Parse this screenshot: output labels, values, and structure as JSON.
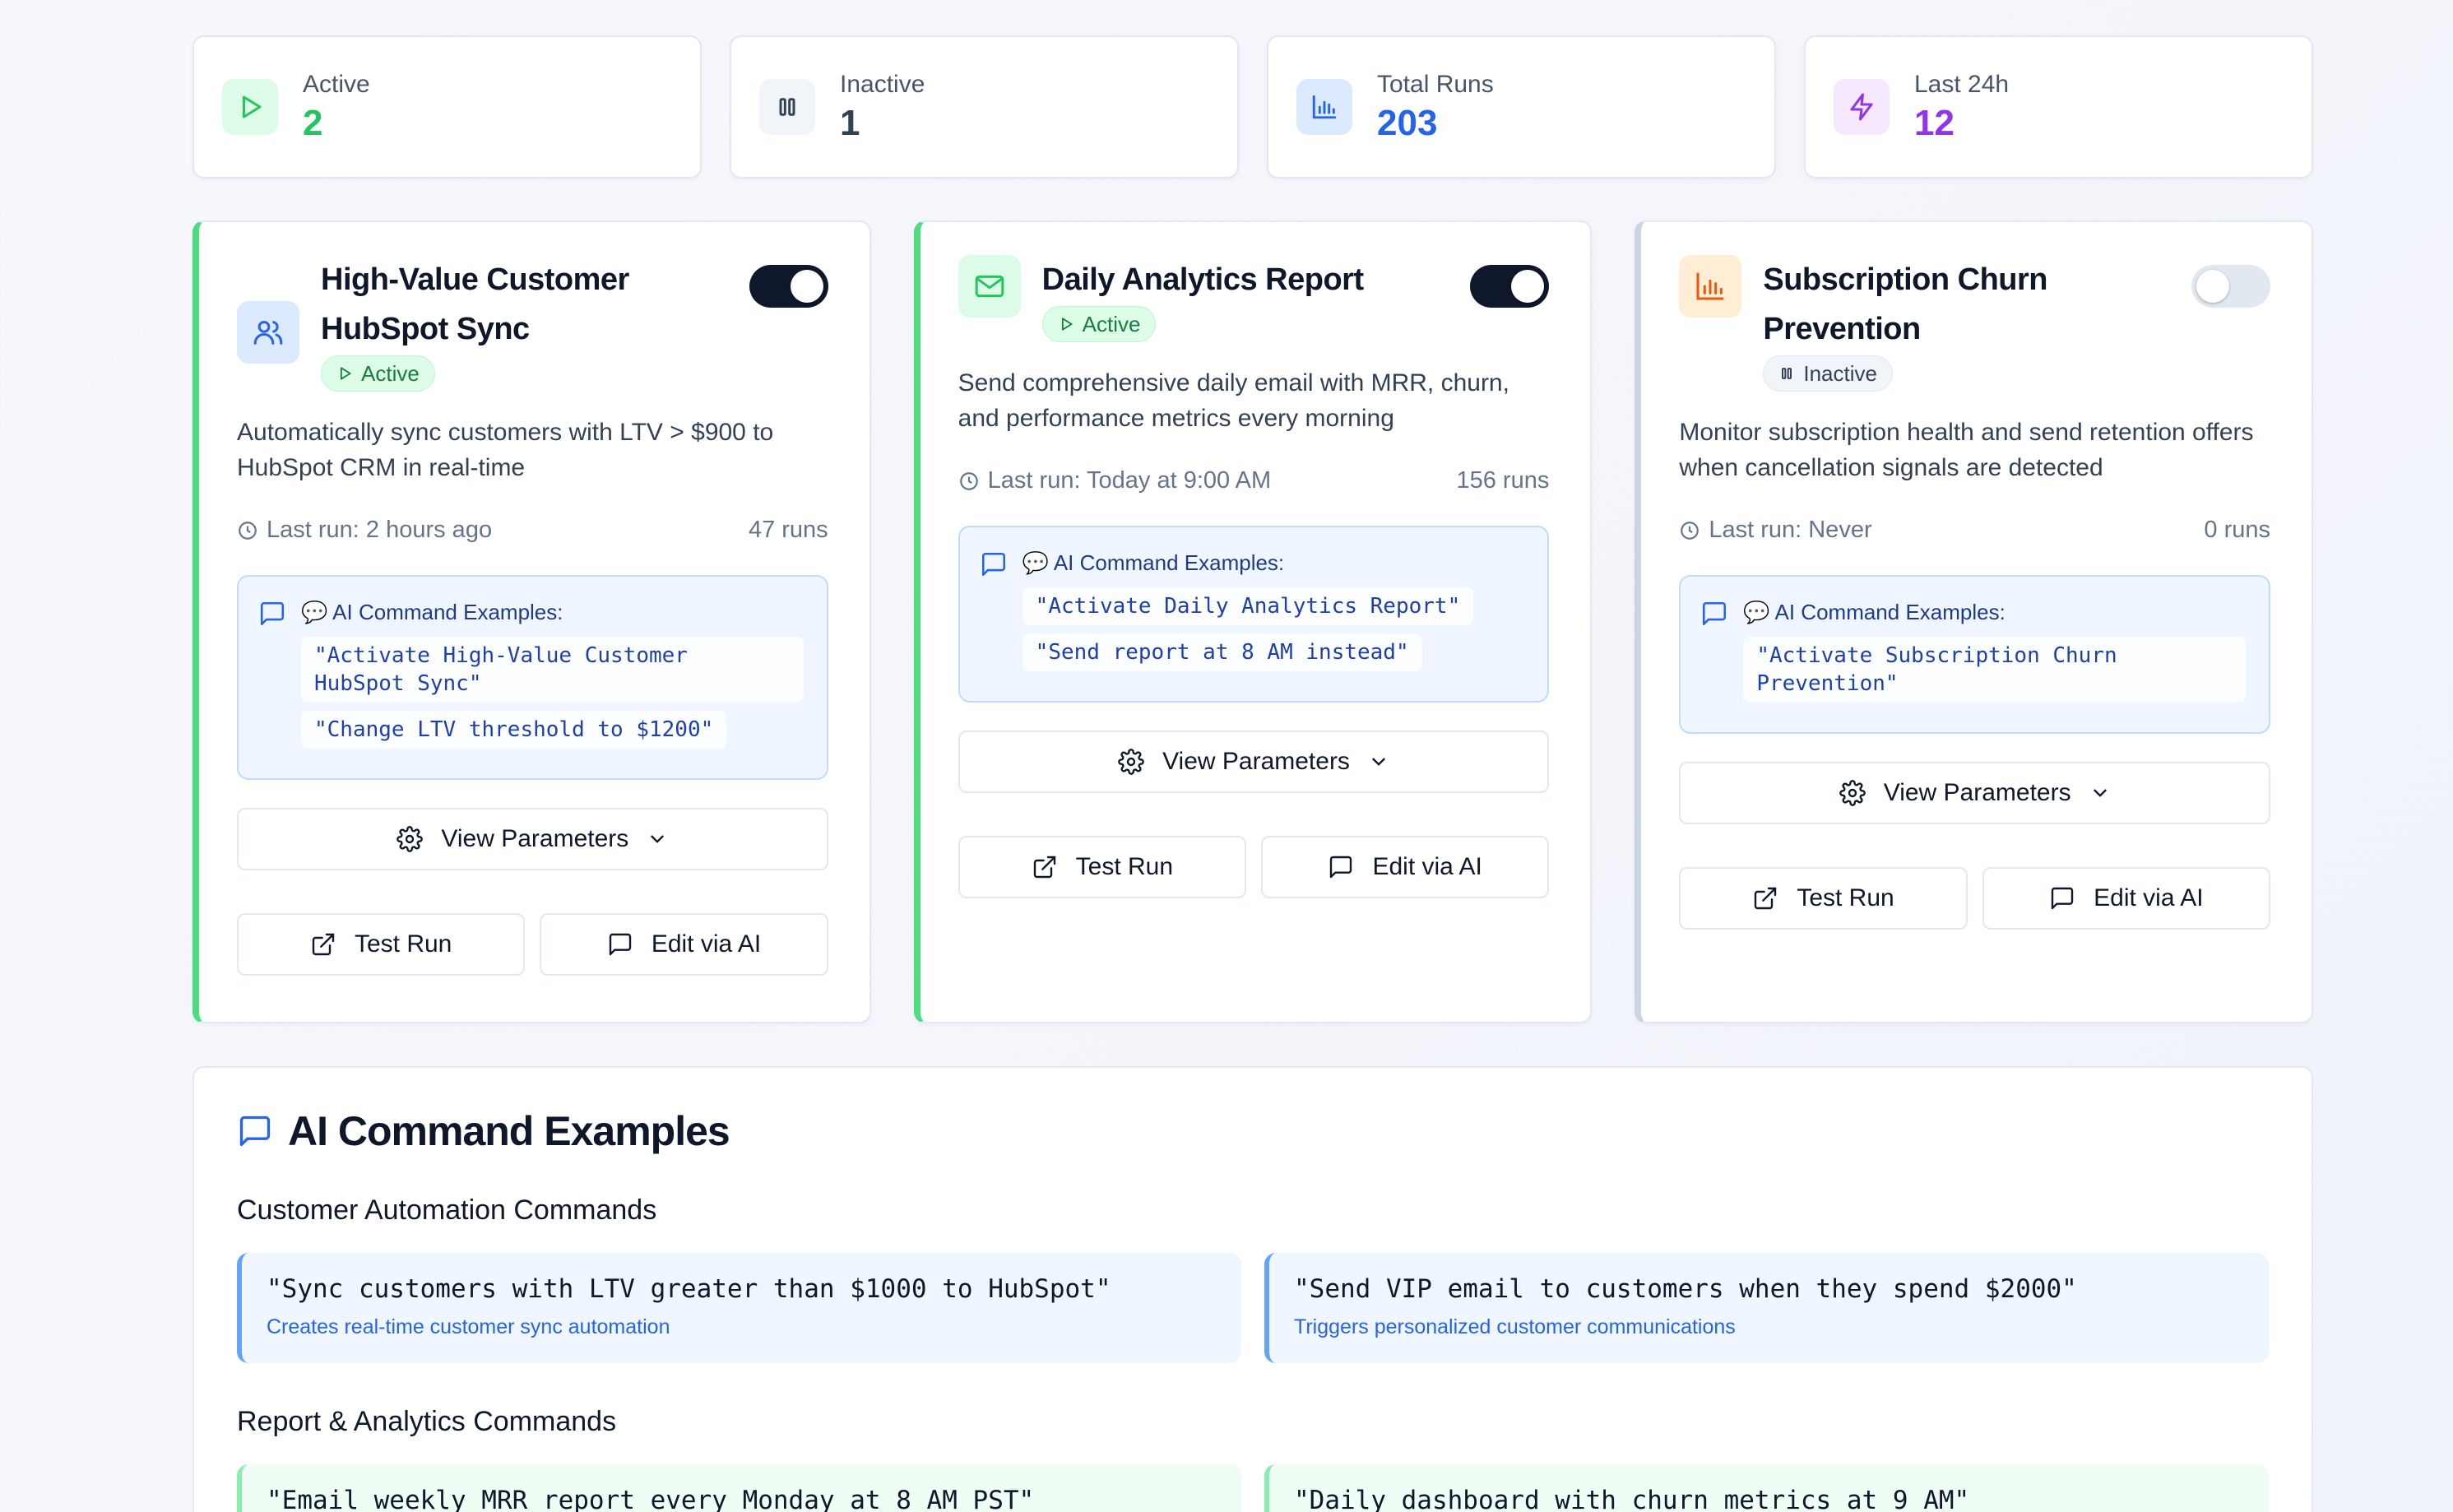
{
  "colors": {
    "active": "#22c55e",
    "inactive_dark": "#334155",
    "total_runs": "#2563eb",
    "last24h": "#9333ea",
    "accent_border_active": "#4ade80",
    "accent_border_inactive": "#cbd5e1"
  },
  "stats": [
    {
      "label": "Active",
      "value": "2",
      "icon": "play-icon"
    },
    {
      "label": "Inactive",
      "value": "1",
      "icon": "pause-icon"
    },
    {
      "label": "Total Runs",
      "value": "203",
      "icon": "bar-chart-icon"
    },
    {
      "label": "Last 24h",
      "value": "12",
      "icon": "lightning-icon"
    }
  ],
  "automations": [
    {
      "title": "High-Value Customer HubSpot Sync",
      "status": "Active",
      "enabled": true,
      "icon": "users-icon",
      "description": "Automatically sync customers with LTV > $900 to HubSpot CRM in real-time",
      "last_run": "Last run: 2 hours ago",
      "runs": "47 runs",
      "examples_title": "💬 AI Command Examples:",
      "examples": [
        "\"Activate High-Value Customer HubSpot Sync\"",
        "\"Change LTV threshold to $1200\""
      ]
    },
    {
      "title": "Daily Analytics Report",
      "status": "Active",
      "enabled": true,
      "icon": "mail-icon",
      "description": "Send comprehensive daily email with MRR, churn, and performance metrics every morning",
      "last_run": "Last run: Today at 9:00 AM",
      "runs": "156 runs",
      "examples_title": "💬 AI Command Examples:",
      "examples": [
        "\"Activate Daily Analytics Report\"",
        "\"Send report at 8 AM instead\""
      ]
    },
    {
      "title": "Subscription Churn Prevention",
      "status": "Inactive",
      "enabled": false,
      "icon": "bar-chart-icon",
      "description": "Monitor subscription health and send retention offers when cancellation signals are detected",
      "last_run": "Last run: Never",
      "runs": "0 runs",
      "examples_title": "💬 AI Command Examples:",
      "examples": [
        "\"Activate Subscription Churn Prevention\""
      ]
    }
  ],
  "buttons": {
    "view_parameters": "View Parameters",
    "test_run": "Test Run",
    "edit_via_ai": "Edit via AI"
  },
  "commands_panel": {
    "title": "AI Command Examples",
    "sections": [
      {
        "title": "Customer Automation Commands",
        "items": [
          {
            "command": "\"Sync customers with LTV greater than $1000 to HubSpot\"",
            "description": "Creates real-time customer sync automation"
          },
          {
            "command": "\"Send VIP email to customers when they spend $2000\"",
            "description": "Triggers personalized customer communications"
          }
        ]
      },
      {
        "title": "Report & Analytics Commands",
        "items": [
          {
            "command": "\"Email weekly MRR report every Monday at 8 AM PST\"",
            "description": ""
          },
          {
            "command": "\"Daily dashboard with churn metrics at 9 AM\"",
            "description": ""
          }
        ]
      }
    ]
  }
}
